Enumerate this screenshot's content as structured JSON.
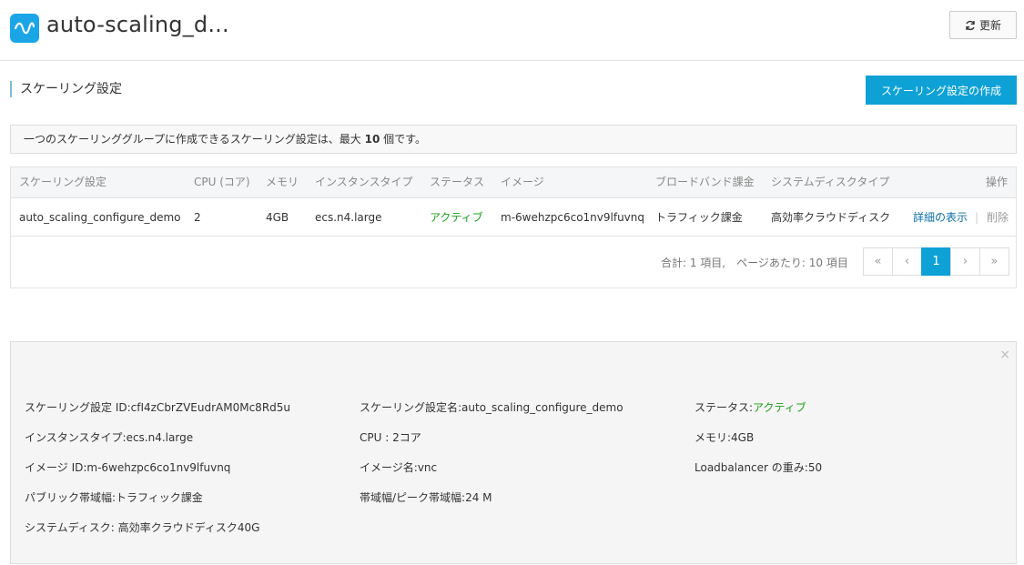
{
  "header": {
    "title": "auto-scaling_d...",
    "refresh_label": "更新"
  },
  "section": {
    "title": "スケーリング設定",
    "create_label": "スケーリング設定の作成"
  },
  "notice": {
    "prefix": "一つのスケーリンググループに作成できるスケーリング設定は、最大 ",
    "count": "10",
    "suffix": " 個です。"
  },
  "table": {
    "columns": [
      "スケーリング設定",
      "CPU (コア)",
      "メモリ",
      "インスタンスタイプ",
      "ステータス",
      "イメージ",
      "ブロードバンド課金",
      "システムディスクタイプ",
      "操作"
    ],
    "rows": [
      {
        "name": "auto_scaling_configure_demo",
        "cpu": "2",
        "memory": "4GB",
        "instance_type": "ecs.n4.large",
        "status": "アクティブ",
        "image": "m-6wehzpc6co1nv9lfuvnq",
        "bandwidth": "トラフィック課金",
        "disk_type": "高効率クラウドディスク",
        "action_details": "詳細の表示",
        "action_sep": "|",
        "action_delete": "削除"
      }
    ]
  },
  "pagination": {
    "summary": "合計: 1 項目,　ページあたり: 10 項目",
    "first": "«",
    "prev": "‹",
    "current": "1",
    "next": "›",
    "last": "»"
  },
  "details": {
    "close": "×",
    "config_id_label": "スケーリング設定 ID:",
    "config_id": "cfI4zCbrZVEudrAM0Mc8Rd5u",
    "config_name_label": "スケーリング設定名:",
    "config_name": "auto_scaling_configure_demo",
    "status_label": "ステータス:",
    "status": "アクティブ",
    "instance_type_label": "インスタンスタイプ:",
    "instance_type": "ecs.n4.large",
    "cpu_label": "CPU : ",
    "cpu": "2コア",
    "memory_label": "メモリ:",
    "memory": "4GB",
    "image_id_label": "イメージ ID:",
    "image_id": "m-6wehzpc6co1nv9lfuvnq",
    "image_name_label": "イメージ名:",
    "image_name": "vnc",
    "lb_weight_label": "Loadbalancer の重み:",
    "lb_weight": "50",
    "public_bw_label": "パブリック帯域幅:",
    "public_bw": "トラフィック課金",
    "peak_bw_label": "帯域幅/ピーク帯域幅:",
    "peak_bw": "24 M",
    "system_disk_label": "システムディスク: ",
    "system_disk": "高効率クラウドディスク40G"
  },
  "colors": {
    "accent": "#0ea1d6",
    "active_status": "#19a11a",
    "link": "#0b6fa8"
  }
}
